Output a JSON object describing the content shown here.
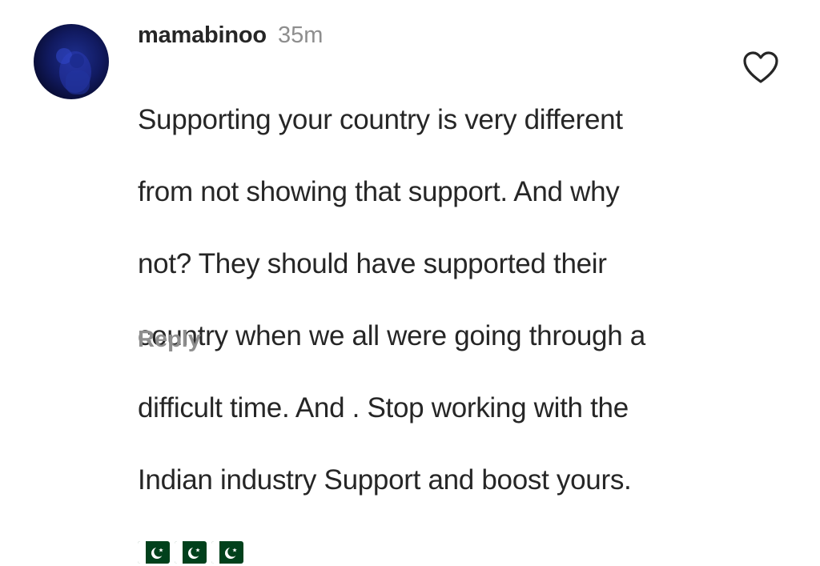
{
  "comment": {
    "username": "mamabinoo",
    "time": "35m",
    "lines": [
      "Supporting your country is very different",
      "from not showing that support. And why",
      "not?  They should have supported their",
      "country when we all were going through a",
      "difficult time. And . Stop working with the",
      "Indian industry Support and boost yours."
    ],
    "emojis": [
      "pakistan-flag",
      "pakistan-flag",
      "pakistan-flag"
    ],
    "reply_label": "Reply",
    "like_icon": "heart-outline-icon",
    "colors": {
      "text": "#262626",
      "secondary": "#8e8e8e",
      "flag_green": "#01411c"
    }
  }
}
